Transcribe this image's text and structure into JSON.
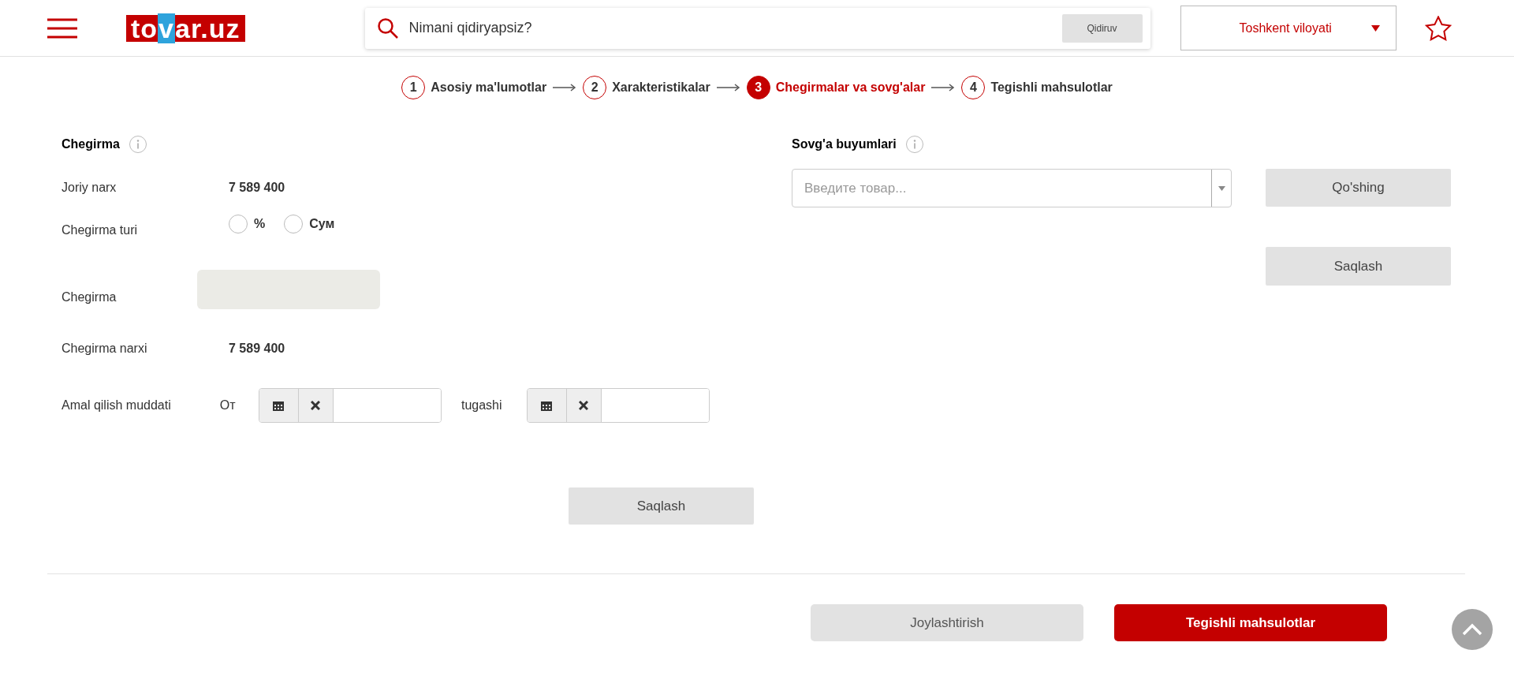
{
  "header": {
    "logo": "tovar.uz",
    "search": {
      "placeholder": "Nimani qidiryapsiz?",
      "button": "Qidiruv"
    },
    "region": "Toshkent viloyati"
  },
  "steps": [
    {
      "number": "1",
      "label": "Asosiy ma'lumotlar",
      "selected": false
    },
    {
      "number": "2",
      "label": "Xarakteristikalar",
      "selected": false
    },
    {
      "number": "3",
      "label": "Chegirmalar va sovg'alar",
      "selected": true
    },
    {
      "number": "4",
      "label": "Tegishli mahsulotlar",
      "selected": false
    }
  ],
  "discount": {
    "title": "Chegirma",
    "current_price": {
      "label": "Joriy narx",
      "value": "7 589 400"
    },
    "type": {
      "label": "Chegirma turi",
      "options": [
        {
          "label": "%",
          "checked": false
        },
        {
          "label": "Сум",
          "checked": false
        }
      ]
    },
    "amount": {
      "label": "Chegirma"
    },
    "discount_price": {
      "label": "Chegirma narxi",
      "value": "7 589 400"
    },
    "period": {
      "label": "Amal qilish muddati",
      "from_label": "От",
      "to_label": "tugashi"
    },
    "save_button": "Saqlash"
  },
  "gifts": {
    "title": "Sovg'a buyumlari",
    "select_placeholder": "Введите товар...",
    "add_button": "Qo'shing",
    "save_button": "Saqlash"
  },
  "footer": {
    "buttons": [
      {
        "label": "Joylashtirish",
        "kind": "secondary"
      },
      {
        "label": "Tegishli mahsulotlar",
        "kind": "primary"
      }
    ]
  }
}
